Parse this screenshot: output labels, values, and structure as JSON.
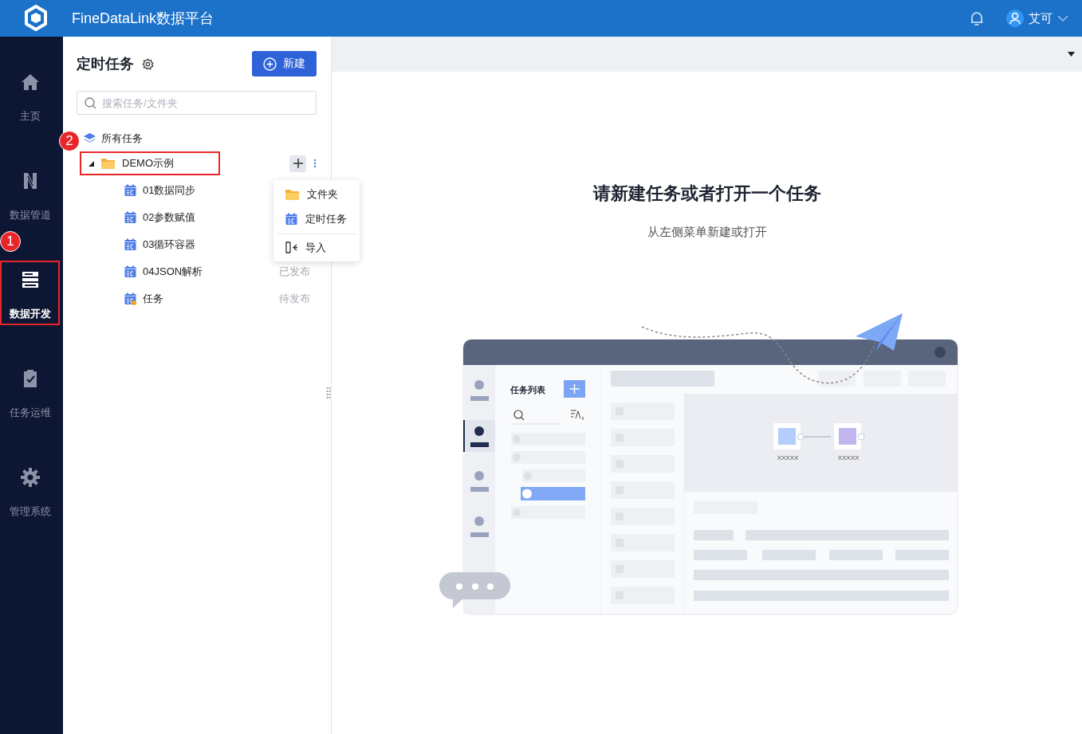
{
  "header": {
    "title": "FineDataLink数据平台",
    "user": {
      "name": "艾可"
    }
  },
  "nav": [
    {
      "label": "主页",
      "selected": false
    },
    {
      "label": "数据管道",
      "selected": false
    },
    {
      "label": "数据开发",
      "selected": true
    },
    {
      "label": "任务运维",
      "selected": false
    },
    {
      "label": "管理系统",
      "selected": false
    }
  ],
  "panel": {
    "title": "定时任务",
    "new_button": "新建",
    "search": {
      "placeholder": "搜索任务/文件夹"
    },
    "tree": [
      {
        "label": "所有任务",
        "kind": "root",
        "children": [
          {
            "label": "DEMO示例",
            "kind": "folder",
            "expanded": true,
            "children": [
              {
                "label": "01数据同步",
                "kind": "task",
                "warning": false
              },
              {
                "label": "02参数赋值",
                "kind": "task",
                "warning": false
              },
              {
                "label": "03循环容器",
                "kind": "task",
                "warning": false
              },
              {
                "label": "04JSON解析",
                "kind": "task",
                "warning": false,
                "status": "已发布"
              },
              {
                "label": "任务",
                "kind": "task",
                "warning": true,
                "status": "待发布"
              }
            ]
          }
        ]
      }
    ]
  },
  "add_menu": {
    "items": [
      {
        "label": "文件夹",
        "kind": "folder",
        "divider_before": false
      },
      {
        "label": "定时任务",
        "kind": "task",
        "divider_before": false
      },
      {
        "label": "导入",
        "kind": "import",
        "divider_before": true
      }
    ]
  },
  "empty_state": {
    "title": "请新建任务或者打开一个任务",
    "subtitle": "从左侧菜单新建或打开",
    "illustration": {
      "list_title": "任务列表",
      "node_labels": [
        "XXXXX",
        "XXXXX"
      ]
    }
  },
  "callouts": [
    {
      "number": "1"
    },
    {
      "number": "2"
    }
  ]
}
